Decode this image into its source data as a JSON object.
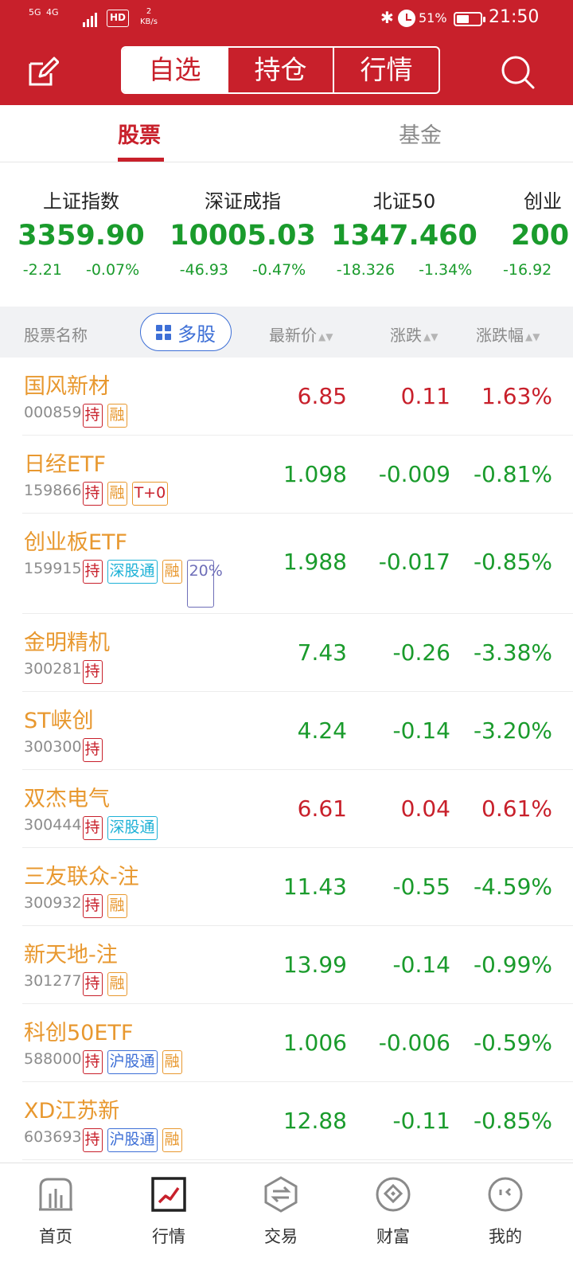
{
  "status_bar": {
    "network": "5G",
    "network2": "4G",
    "hd": "HD",
    "speed_value": "2",
    "speed_unit": "KB/s",
    "battery": "51%",
    "time": "21:50"
  },
  "header": {
    "tabs": [
      {
        "label": "自选",
        "active": true
      },
      {
        "label": "持仓",
        "active": false
      },
      {
        "label": "行情",
        "active": false
      }
    ]
  },
  "subtabs": [
    {
      "label": "股票",
      "active": true
    },
    {
      "label": "基金",
      "active": false
    }
  ],
  "indices": [
    {
      "name": "上证指数",
      "value": "3359.90",
      "change": "-2.21",
      "percent": "-0.07%"
    },
    {
      "name": "深证成指",
      "value": "10005.03",
      "change": "-46.93",
      "percent": "-0.47%"
    },
    {
      "name": "北证50",
      "value": "1347.460",
      "change": "-18.326",
      "percent": "-1.34%"
    },
    {
      "name": "创业",
      "value": "200",
      "change": "-16.92",
      "percent": ""
    }
  ],
  "table_header": {
    "name": "股票名称",
    "multi": "多股",
    "price": "最新价",
    "change": "涨跌",
    "percent": "涨跌幅"
  },
  "rows": [
    {
      "name": "国风新材",
      "code": "000859",
      "tags": [
        "持",
        "融"
      ],
      "price": "6.85",
      "change": "0.11",
      "percent": "1.63%",
      "dir": "up"
    },
    {
      "name": "日经ETF",
      "code": "159866",
      "tags": [
        "持",
        "融",
        "T+0"
      ],
      "price": "1.098",
      "change": "-0.009",
      "percent": "-0.81%",
      "dir": "down"
    },
    {
      "name": "创业板ETF",
      "code": "159915",
      "tags": [
        "持",
        "深股通",
        "融",
        "20%"
      ],
      "price": "1.988",
      "change": "-0.017",
      "percent": "-0.85%",
      "dir": "down"
    },
    {
      "name": "金明精机",
      "code": "300281",
      "tags": [
        "持"
      ],
      "price": "7.43",
      "change": "-0.26",
      "percent": "-3.38%",
      "dir": "down"
    },
    {
      "name": "ST峡创",
      "code": "300300",
      "tags": [
        "持"
      ],
      "price": "4.24",
      "change": "-0.14",
      "percent": "-3.20%",
      "dir": "down"
    },
    {
      "name": "双杰电气",
      "code": "300444",
      "tags": [
        "持",
        "深股通"
      ],
      "price": "6.61",
      "change": "0.04",
      "percent": "0.61%",
      "dir": "up"
    },
    {
      "name": "三友联众-注",
      "code": "300932",
      "tags": [
        "持",
        "融"
      ],
      "price": "11.43",
      "change": "-0.55",
      "percent": "-4.59%",
      "dir": "down"
    },
    {
      "name": "新天地-注",
      "code": "301277",
      "tags": [
        "持",
        "融"
      ],
      "price": "13.99",
      "change": "-0.14",
      "percent": "-0.99%",
      "dir": "down"
    },
    {
      "name": "科创50ETF",
      "code": "588000",
      "tags": [
        "持",
        "沪股通",
        "融"
      ],
      "price": "1.006",
      "change": "-0.006",
      "percent": "-0.59%",
      "dir": "down"
    },
    {
      "name": "XD江苏新",
      "code": "603693",
      "tags": [
        "持",
        "沪股通",
        "融"
      ],
      "price": "12.88",
      "change": "-0.11",
      "percent": "-0.85%",
      "dir": "down"
    }
  ],
  "bottom_nav": [
    {
      "label": "首页",
      "icon": "home-chart-icon"
    },
    {
      "label": "行情",
      "icon": "market-trend-icon",
      "active": true
    },
    {
      "label": "交易",
      "icon": "trade-exchange-icon"
    },
    {
      "label": "财富",
      "icon": "wealth-diamond-icon"
    },
    {
      "label": "我的",
      "icon": "profile-face-icon"
    }
  ],
  "colors": {
    "brand_red": "#c8202b",
    "up_red": "#c8202b",
    "down_green": "#1a9b2c",
    "name_orange": "#e8982f"
  }
}
